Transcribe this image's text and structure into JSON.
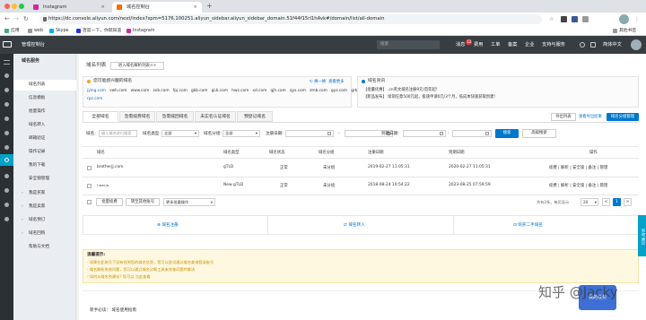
{
  "browser": {
    "tabs": [
      {
        "title": "Instagram",
        "active": false
      },
      {
        "title": "域名控制台",
        "active": true
      }
    ],
    "new_tab": "+",
    "url": "https://dc.console.aliyun.com/next/index?spm=5176.100251.aliyun_sidebar.aliyun_sidebar_domain.51f44f15rl1hAvk#/domain/list/all-domain",
    "bookmarks": [
      "应用",
      "web",
      "Skype",
      "百度一下，你就知道",
      "Instagram"
    ],
    "extra_bookmarks": "其他书签"
  },
  "topbar": {
    "title": "管理控制台",
    "search_placeholder": "搜索",
    "items": [
      "消息",
      "费用",
      "工单",
      "备案",
      "企业",
      "支持与服务",
      "简体中文"
    ],
    "message_badge": "12"
  },
  "sidebar": {
    "header": "域名服务",
    "items": [
      {
        "label": "域名列表",
        "active": true
      },
      {
        "label": "信息模板"
      },
      {
        "label": "批量操作"
      },
      {
        "label": "域名转入"
      },
      {
        "label": "邮箱验证"
      },
      {
        "label": "操作记录"
      },
      {
        "label": "我的下载"
      },
      {
        "label": "安全锁管理"
      }
    ],
    "groups": [
      "我是买家",
      "我是卖家",
      "域名预订",
      "域名回购",
      "帮助与文档"
    ]
  },
  "main": {
    "breadcrumb": "域名列表",
    "enter_old_button": "进入域名解析列表>>",
    "panel_left": {
      "title": "您可能感兴趣的域名",
      "refresh": "换一换",
      "more": "查看更多",
      "domains_row1": [
        "jying.com",
        "vwh.com",
        "www.com",
        "zxb.com",
        "fpj.com",
        "gkb.com",
        "gLb.com",
        "hwz.com",
        "xd.com",
        "qjh.com",
        "qys.com",
        "zmb.com",
        "gyz.com",
        "grb.com"
      ],
      "domains_row2": [
        "rpz.com"
      ]
    },
    "panel_right": {
      "title": "域名资讯",
      "news1": "【批量优惠】 .cn英文域名注册9元/首年起!",
      "news2": "【新品发布】 续销任意500元起，极速申请0元/3个月，低成本快速获取创建!"
    },
    "tabs": [
      "全部域名",
      "急需续费域名",
      "急需赎回域名",
      "未实名认证域名",
      "预登记域名"
    ],
    "actions": [
      "导出列表",
      "查看导出结果",
      "域名分组管理"
    ],
    "filters": {
      "domain_label": "域名:",
      "domain_placeholder": "输入域名进行搜索",
      "type_label": "域名类型:",
      "type_value": "全部",
      "group_label": "域名分组:",
      "group_value": "全部",
      "reg_label": "注册日期:",
      "exp_label": "到期日期:",
      "range_sep": "-",
      "search": "搜索",
      "advanced": "高级搜索"
    },
    "table": {
      "headers": [
        "域名",
        "域名类型",
        "域名状态",
        "域名分组",
        "注册日期",
        "到期日期",
        "操作"
      ],
      "rows": [
        {
          "domain": "brotherjj.com",
          "type": "gTLD",
          "status": "正常",
          "group": "未分组",
          "reg": "2019-02-27 11:05:31",
          "exp": "2020-02-27 11:05:31",
          "ops": "续费 | 解析 | 安全锁 | 备注 | 管理"
        },
        {
          "domain": "i-wei.w",
          "type": "New gTLD",
          "status": "正常",
          "group": "未分组",
          "reg": "2018-08-24 10:54:22",
          "exp": "2023-08-25 07:59:59",
          "ops": "续费 | 解析 | 安全锁 | 备注 | 管理"
        }
      ]
    },
    "footer_actions": [
      "批量续费",
      "转至其他账号",
      "更多批量操作"
    ],
    "pagination": {
      "summary": "共有2条，每页显示",
      "per_page": "20",
      "prev": "<",
      "page": "1",
      "next": ">"
    },
    "quick_links": [
      "域名注册",
      "域名转入",
      "购买二手域名"
    ],
    "notice": {
      "title": "温馨提示:",
      "lines": [
        "- 如果在此账号下没有找到您的域名信息，您可以尝试通过域名查询登录账号",
        "- 域名解析失效问题，您可以通过域名诊断工具来排查问题并解决",
        "- 如何从域名到建站? 您可以 点此查看"
      ]
    },
    "guide": "新手必读：  域名使用指南"
  },
  "floating": {
    "side_tab": "咨询·建议",
    "promo": "我的任务"
  },
  "watermark": "知乎 @Jacky"
}
